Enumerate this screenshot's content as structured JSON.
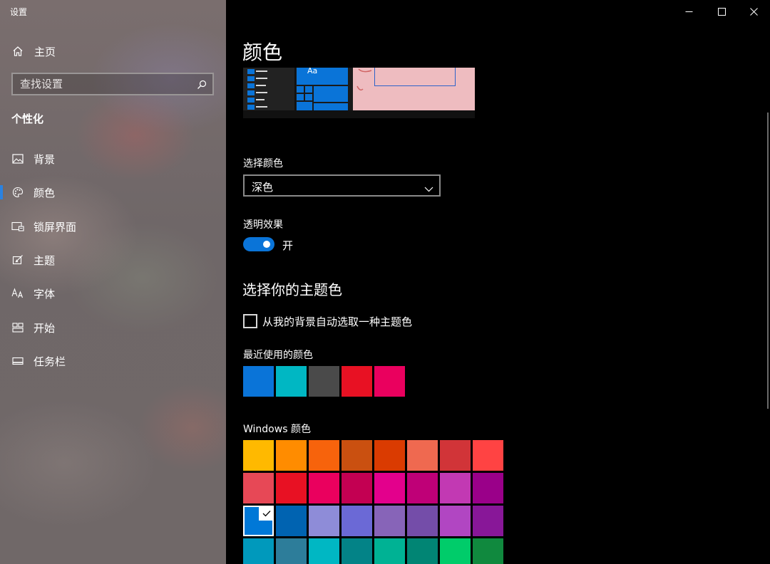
{
  "window": {
    "title": "设置",
    "minimize_icon": "minimize-icon",
    "maximize_icon": "maximize-icon",
    "close_icon": "close-icon"
  },
  "sidebar": {
    "home_label": "主页",
    "search_placeholder": "查找设置",
    "section_title": "个性化",
    "items": [
      {
        "label": "背景",
        "icon": "picture-icon"
      },
      {
        "label": "颜色",
        "icon": "palette-icon",
        "active": true
      },
      {
        "label": "锁屏界面",
        "icon": "lock-screen-icon"
      },
      {
        "label": "主题",
        "icon": "theme-icon"
      },
      {
        "label": "字体",
        "icon": "font-icon"
      },
      {
        "label": "开始",
        "icon": "start-icon"
      },
      {
        "label": "任务栏",
        "icon": "taskbar-icon"
      }
    ],
    "accent_color": "#2a82e0"
  },
  "main": {
    "title": "颜色",
    "preview": {
      "sample_text": "Aa"
    },
    "choose_color_label": "选择颜色",
    "color_mode_value": "深色",
    "transparency_label": "透明效果",
    "transparency_state": "开",
    "transparency_on": true,
    "accent_heading": "选择你的主题色",
    "auto_pick_label": "从我的背景自动选取一种主题色",
    "auto_pick_checked": false,
    "recent_label": "最近使用的颜色",
    "recent_colors": [
      "#0a74d8",
      "#00b7c3",
      "#4a4a4a",
      "#e81123",
      "#ea005e"
    ],
    "windows_colors_label": "Windows 颜色",
    "windows_colors": [
      [
        "#ffb900",
        "#ff8c00",
        "#f7630c",
        "#ca5010",
        "#da3b01",
        "#ef6950",
        "#d13438",
        "#ff4343"
      ],
      [
        "#e74856",
        "#e81123",
        "#ea005e",
        "#c30052",
        "#e3008c",
        "#bf0077",
        "#c239b3",
        "#9a0089"
      ],
      [
        "#0078d7",
        "#0063b1",
        "#8e8cd8",
        "#6b69d6",
        "#8764b8",
        "#744da9",
        "#b146c2",
        "#881798"
      ],
      [
        "#0099bc",
        "#2d7d9a",
        "#00b7c3",
        "#038387",
        "#00b294",
        "#018574",
        "#00cc6a",
        "#10893e"
      ]
    ],
    "selected_color": "#0078d7"
  }
}
